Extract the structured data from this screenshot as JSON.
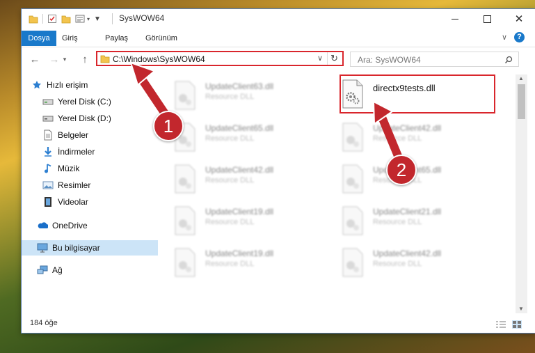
{
  "window": {
    "title": "SysWOW64"
  },
  "ribbon": {
    "tabs": [
      "Dosya",
      "Giriş",
      "Paylaş",
      "Görünüm"
    ]
  },
  "nav": {
    "address": "C:\\Windows\\SysWOW64",
    "search_placeholder": "Ara: SysWOW64"
  },
  "sidebar": {
    "items": [
      {
        "label": "Hızlı erişim",
        "icon": "star-icon"
      },
      {
        "label": "Yerel Disk (C:)",
        "icon": "drive-icon",
        "pinned": true
      },
      {
        "label": "Yerel Disk (D:)",
        "icon": "drive-icon",
        "pinned": true
      },
      {
        "label": "Belgeler",
        "icon": "documents-icon",
        "pinned": true
      },
      {
        "label": "İndirmeler",
        "icon": "download-icon",
        "pinned": true
      },
      {
        "label": "Müzik",
        "icon": "music-icon",
        "pinned": true
      },
      {
        "label": "Resimler",
        "icon": "pictures-icon",
        "pinned": true
      },
      {
        "label": "Videolar",
        "icon": "videos-icon",
        "pinned": true
      },
      {
        "label": "OneDrive",
        "icon": "cloud-icon"
      },
      {
        "label": "Bu bilgisayar",
        "icon": "computer-icon",
        "selected": true
      },
      {
        "label": "Ağ",
        "icon": "network-icon"
      }
    ]
  },
  "files": {
    "highlighted": {
      "name": "directx9tests.dll"
    },
    "left": [
      {
        "name": "UpdateClient63.dll",
        "desc": "Resource DLL"
      },
      {
        "name": "UpdateClient65.dll",
        "desc": "Resource DLL"
      },
      {
        "name": "UpdateClient42.dll",
        "desc": "Resource DLL"
      },
      {
        "name": "UpdateClient19.dll",
        "desc": "Resource DLL"
      },
      {
        "name": "UpdateClient19.dll",
        "desc": "Resource DLL"
      }
    ],
    "right": [
      {
        "name": "UpdateClient42.dll",
        "desc": "Resource DLL"
      },
      {
        "name": "UpdateClient65.dll",
        "desc": "Resource DLL"
      },
      {
        "name": "UpdateClient21.dll",
        "desc": "Resource DLL"
      },
      {
        "name": "UpdateClient42.dll",
        "desc": "Resource DLL"
      }
    ]
  },
  "status": {
    "count": "184 öğe"
  },
  "annotations": {
    "step1": "1",
    "step2": "2"
  },
  "colors": {
    "accent": "#1979ca",
    "highlight": "#d9262c",
    "selected": "#cce4f7"
  }
}
